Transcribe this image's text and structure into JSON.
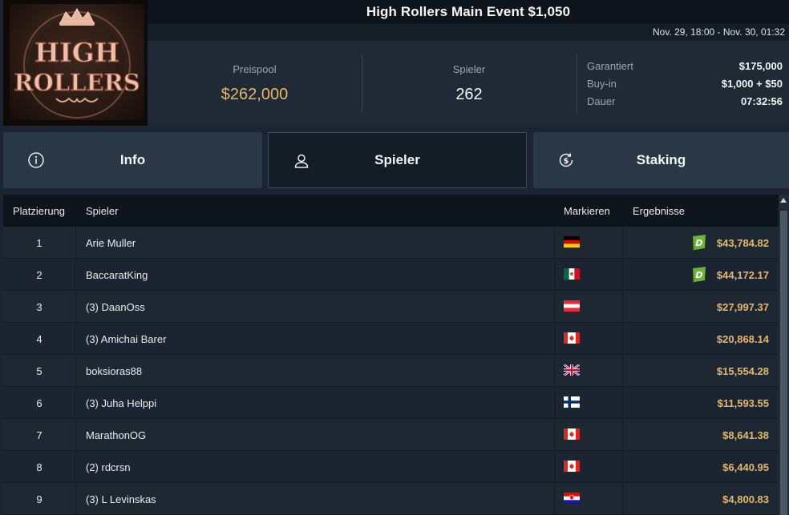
{
  "event": {
    "title": "High Rollers Main Event $1,050",
    "dates": "Nov. 29, 18:00 - Nov. 30, 01:32",
    "logo_text": "HIGH ROLLERS"
  },
  "stats": {
    "prize_pool_label": "Preispool",
    "prize_pool_value": "$262,000",
    "players_label": "Spieler",
    "players_value": "262"
  },
  "details": [
    {
      "key": "Garantiert",
      "value": "$175,000"
    },
    {
      "key": "Buy-in",
      "value": "$1,000 + $50"
    },
    {
      "key": "Dauer",
      "value": "07:32:56"
    }
  ],
  "tabs": [
    {
      "label": "Info",
      "icon": "info-icon",
      "active": false
    },
    {
      "label": "Spieler",
      "icon": "user-icon",
      "active": true
    },
    {
      "label": "Staking",
      "icon": "dollar-refresh-icon",
      "active": false
    }
  ],
  "table": {
    "headers": {
      "rank": "Platzierung",
      "player": "Spieler",
      "mark": "Markieren",
      "results": "Ergebnisse"
    },
    "rows": [
      {
        "rank": "1",
        "name": "Arie Muller",
        "flag": "germany",
        "result": "$43,784.82",
        "badge": true
      },
      {
        "rank": "2",
        "name": "BaccaratKing",
        "flag": "mexico",
        "result": "$44,172.17",
        "badge": true
      },
      {
        "rank": "3",
        "name": "(3) DaanOss",
        "flag": "austria",
        "result": "$27,997.37",
        "badge": false
      },
      {
        "rank": "4",
        "name": "(3) Amichai Barer",
        "flag": "canada",
        "result": "$20,868.14",
        "badge": false
      },
      {
        "rank": "5",
        "name": "boksioras88",
        "flag": "uk",
        "result": "$15,554.28",
        "badge": false
      },
      {
        "rank": "6",
        "name": "(3) Juha Helppi",
        "flag": "finland",
        "result": "$11,593.55",
        "badge": false
      },
      {
        "rank": "7",
        "name": "MarathonOG",
        "flag": "canada",
        "result": "$8,641.38",
        "badge": false
      },
      {
        "rank": "8",
        "name": "(2) rdcrsn",
        "flag": "canada",
        "result": "$6,440.95",
        "badge": false
      },
      {
        "rank": "9",
        "name": "(3) L Levinskas",
        "flag": "croatia",
        "result": "$4,800.83",
        "badge": false
      }
    ]
  },
  "badge_letter": "D",
  "colors": {
    "accent_gold": "#e7b764",
    "badge_green": "#6fb23b",
    "panel": "#1f2a36",
    "dark": "#0e141b"
  }
}
